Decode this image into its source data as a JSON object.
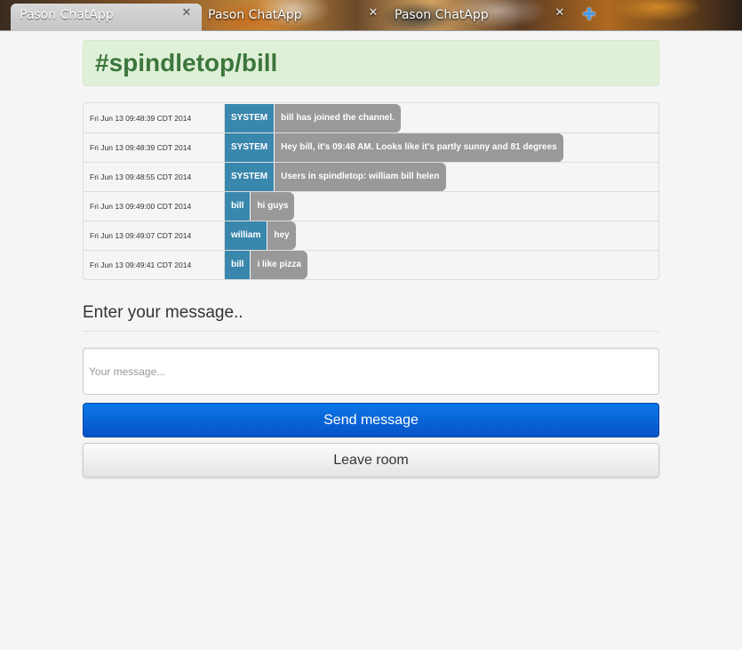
{
  "browser": {
    "tabs": [
      {
        "label": "Pason ChatApp",
        "close": "✕"
      },
      {
        "label": "Pason ChatApp",
        "close": "✕"
      },
      {
        "label": "Pason ChatApp",
        "close": "✕"
      }
    ],
    "new_tab_icon": "plus-icon"
  },
  "channel": {
    "title": "#spindletop/bill"
  },
  "messages": [
    {
      "time": "Fri Jun 13 09:48:39 CDT 2014",
      "user": "SYSTEM",
      "text": "bill has joined the channel."
    },
    {
      "time": "Fri Jun 13 09:48:39 CDT 2014",
      "user": "SYSTEM",
      "text": "Hey bill, it's 09:48 AM. Looks like it's partly sunny and 81 degrees"
    },
    {
      "time": "Fri Jun 13 09:48:55 CDT 2014",
      "user": "SYSTEM",
      "text": "Users in spindletop: william bill helen"
    },
    {
      "time": "Fri Jun 13 09:49:00 CDT 2014",
      "user": "bill",
      "text": "hi guys"
    },
    {
      "time": "Fri Jun 13 09:49:07 CDT 2014",
      "user": "william",
      "text": "hey"
    },
    {
      "time": "Fri Jun 13 09:49:41 CDT 2014",
      "user": "bill",
      "text": "i like pizza"
    }
  ],
  "compose": {
    "heading": "Enter your message..",
    "input_value": "",
    "input_placeholder": "Your message...",
    "send_label": "Send message",
    "leave_label": "Leave room"
  },
  "colors": {
    "header_bg": "#dff0d8",
    "header_text": "#3c763d",
    "user_badge": "#3a87ad",
    "message_bubble": "#999999",
    "send_button": "#0853c6"
  }
}
